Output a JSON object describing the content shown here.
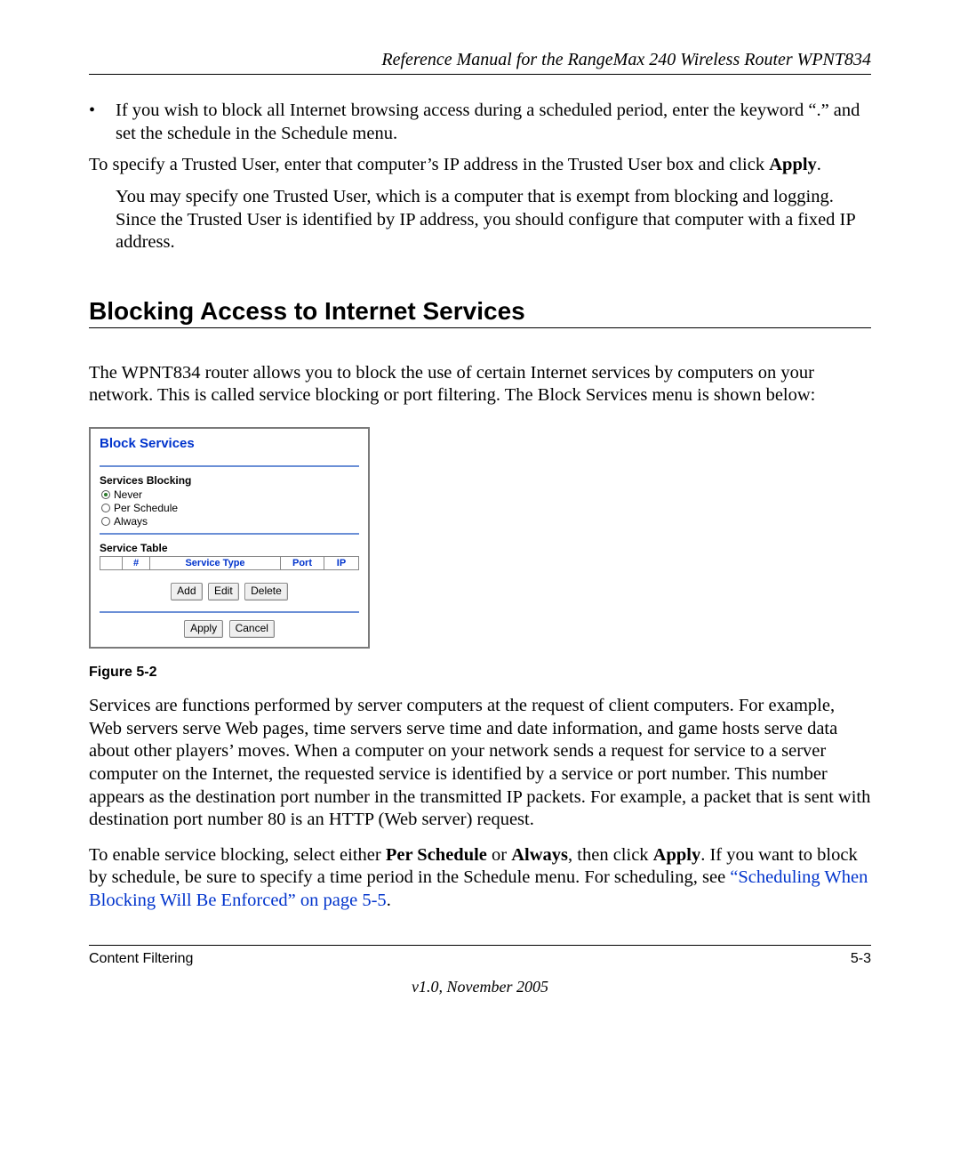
{
  "header": {
    "title": "Reference Manual for the RangeMax 240 Wireless Router WPNT834"
  },
  "bullet1": "If you wish to block all Internet browsing access during a scheduled period, enter the keyword “.” and set the schedule in the Schedule menu.",
  "para_trusted_intro_pre": "To specify a Trusted User, enter that computer’s IP address in the Trusted User box and click ",
  "apply_bold": "Apply",
  "period": ".",
  "para_trusted_body": "You may specify one Trusted User, which is a computer that is exempt from blocking and logging. Since the Trusted User is identified by IP address, you should configure that computer with a fixed IP address.",
  "section_heading": "Blocking Access to Internet Services",
  "para_section_intro": "The WPNT834 router allows you to block the use of certain Internet services by computers on your network. This is called service blocking or port filtering. The Block Services menu is shown below:",
  "screenshot": {
    "title": "Block Services",
    "services_blocking_label": "Services Blocking",
    "radios": {
      "never": "Never",
      "per_schedule": "Per Schedule",
      "always": "Always"
    },
    "service_table_label": "Service Table",
    "table_headers": {
      "num": "#",
      "service_type": "Service Type",
      "port": "Port",
      "ip": "IP"
    },
    "buttons": {
      "add": "Add",
      "edit": "Edit",
      "delete": "Delete",
      "apply": "Apply",
      "cancel": "Cancel"
    }
  },
  "figure_caption": "Figure 5-2",
  "para_services_explain": "Services are functions performed by server computers at the request of client computers. For example, Web servers serve Web pages, time servers serve time and date information, and game hosts serve data about other players’ moves. When a computer on your network sends a request for service to a server computer on the Internet, the requested service is identified by a service or port number. This number appears as the destination port number in the transmitted IP packets. For example, a packet that is sent with destination port number 80 is an HTTP (Web server) request.",
  "enable_sentence": {
    "p1": "To enable service blocking, select either ",
    "per_schedule": "Per Schedule",
    "or": " or ",
    "always": "Always",
    "then_click": ", then click ",
    "apply": "Apply",
    "p2": ". If you want to block by schedule, be sure to specify a time period in the Schedule menu. For scheduling, see ",
    "link": "“Scheduling When Blocking Will Be Enforced” on page 5-5",
    "end": "."
  },
  "footer": {
    "left": "Content Filtering",
    "right": "5-3",
    "version": "v1.0, November 2005"
  }
}
